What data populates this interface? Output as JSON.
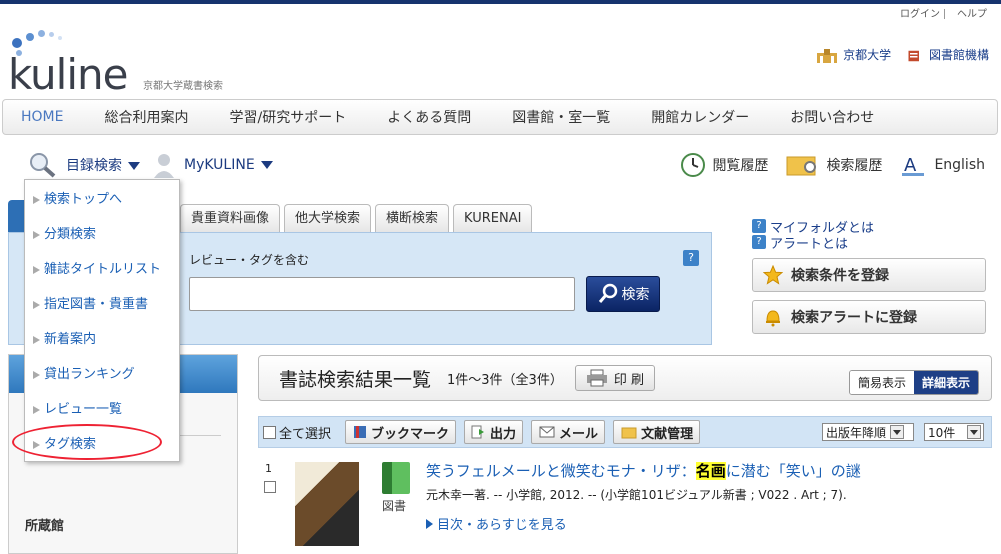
{
  "header": {
    "login": "ログイン",
    "help": "ヘルプ",
    "logo_text": "kuline",
    "logo_sub": "京都大学蔵書検索",
    "links": [
      {
        "label": "京都大学",
        "icon": "university-icon"
      },
      {
        "label": "図書館機構",
        "icon": "library-icon"
      }
    ]
  },
  "global_nav": [
    "HOME",
    "総合利用案内",
    "学習/研究サポート",
    "よくある質問",
    "図書館・室一覧",
    "開館カレンダー",
    "お問い合わせ"
  ],
  "sub_nav": {
    "catalog": "目録検索",
    "mykuline": "MyKULINE",
    "history_view": "閲覧履歴",
    "history_search": "検索履歴",
    "english": "English"
  },
  "dropdown_menu": [
    "検索トップへ",
    "分類検索",
    "雑誌タイトルリスト",
    "指定図書・貴重書",
    "新着案内",
    "貸出ランキング",
    "レビュー一覧",
    "タグ検索"
  ],
  "tabs": [
    "貴重資料画像",
    "他大学検索",
    "横断検索",
    "KURENAI"
  ],
  "search": {
    "option_label": "レビュー・タグを含む",
    "help": "?",
    "input_value": "",
    "button": "検索"
  },
  "right_panel": {
    "links": [
      "マイフォルダとは",
      "アラートとは"
    ],
    "buttons": [
      "検索条件を登録",
      "検索アラートに登録"
    ]
  },
  "results": {
    "title": "書誌検索結果一覧",
    "count": "1件～3件（全3件）",
    "print": "印 刷",
    "view_simple": "簡易表示",
    "view_detail": "詳細表示"
  },
  "toolbar": {
    "select_all": "全て選択",
    "bookmark": "ブックマーク",
    "output": "出力",
    "mail": "メール",
    "refmgr": "文献管理",
    "sort": "出版年降順",
    "per_page": "10件"
  },
  "left_col": {
    "holdings": "所蔵館"
  },
  "result_items": [
    {
      "num": "1",
      "kind": "図書",
      "title_pre": "笑うフェルメールと微笑むモナ・リザ：",
      "title_hl": "名画",
      "title_post": "に潜む「笑い」の謎",
      "meta": "元木幸一著. -- 小学館, 2012. -- (小学館101ビジュアル新書 ; V022 . Art ; 7).",
      "more": "目次・あらすじを見る"
    }
  ],
  "colors": {
    "nav_dark": "#16336e",
    "accent_blue": "#1a5fb4",
    "highlight": "#ffff33",
    "annotation_circle": "#e23"
  }
}
